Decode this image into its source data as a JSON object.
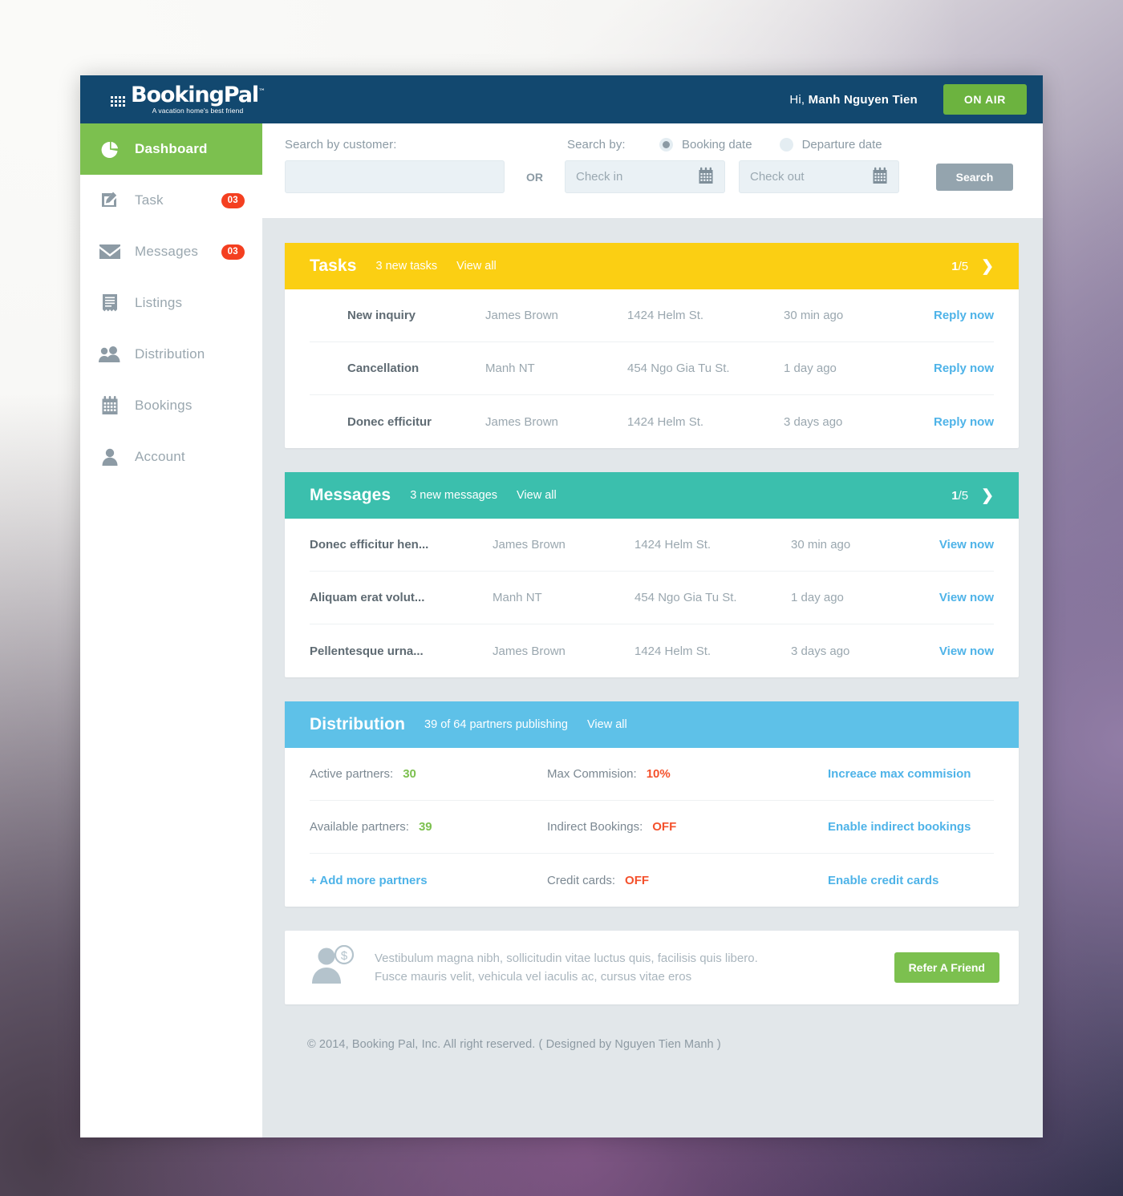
{
  "brand": {
    "logo_main": "BookingPal",
    "logo_tm": "™",
    "logo_sub": "A vacation home's  best friend",
    "accent_blue": "#12486f",
    "accent_green": "#7cc04f",
    "accent_yellow": "#fbcf13",
    "accent_teal": "#3bbfad",
    "accent_lightblue": "#5ec1e8",
    "accent_red": "#f4512c",
    "link_blue": "#4eb3e8"
  },
  "topbar": {
    "greeting_prefix": "Hi, ",
    "user_name": "Manh Nguyen Tien",
    "on_air_label": "ON AIR"
  },
  "sidebar": {
    "items": [
      {
        "label": "Dashboard",
        "icon": "pie-chart-icon",
        "badge": null,
        "active": true
      },
      {
        "label": "Task",
        "icon": "edit-note-icon",
        "badge": "03",
        "active": false
      },
      {
        "label": "Messages",
        "icon": "envelope-icon",
        "badge": "03",
        "active": false
      },
      {
        "label": "Listings",
        "icon": "receipt-icon",
        "badge": null,
        "active": false
      },
      {
        "label": "Distribution",
        "icon": "people-icon",
        "badge": null,
        "active": false
      },
      {
        "label": "Bookings",
        "icon": "calendar-icon",
        "badge": null,
        "active": false
      },
      {
        "label": "Account",
        "icon": "user-icon",
        "badge": null,
        "active": false
      }
    ]
  },
  "search": {
    "customer_label": "Search by customer:",
    "customer_value": "",
    "customer_placeholder": "",
    "or_label": "OR",
    "search_by_label": "Search by:",
    "radios": [
      {
        "label": "Booking date",
        "selected": true
      },
      {
        "label": "Departure date",
        "selected": false
      }
    ],
    "checkin_placeholder": "Check in",
    "checkin_value": "",
    "checkout_placeholder": "Check out",
    "checkout_value": "",
    "search_button": "Search"
  },
  "tasks_panel": {
    "title": "Tasks",
    "subtitle": "3 new tasks",
    "view_all": "View all",
    "page_current": "1",
    "page_sep": "/",
    "page_total": "5",
    "rows": [
      {
        "title": "New inquiry",
        "name": "James Brown",
        "address": "1424 Helm St.",
        "time": "30 min ago",
        "action": "Reply now"
      },
      {
        "title": "Cancellation",
        "name": "Manh NT",
        "address": "454 Ngo Gia Tu St.",
        "time": "1 day ago",
        "action": "Reply now"
      },
      {
        "title": "Donec efficitur",
        "name": "James Brown",
        "address": "1424 Helm St.",
        "time": "3 days ago",
        "action": "Reply now"
      }
    ]
  },
  "messages_panel": {
    "title": "Messages",
    "subtitle": "3 new messages",
    "view_all": "View all",
    "page_current": "1",
    "page_sep": "/",
    "page_total": "5",
    "rows": [
      {
        "title": "Donec efficitur hen...",
        "name": "James Brown",
        "address": "1424 Helm St.",
        "time": "30 min ago",
        "action": "View now"
      },
      {
        "title": "Aliquam erat volut...",
        "name": "Manh NT",
        "address": "454 Ngo Gia Tu St.",
        "time": "1 day ago",
        "action": "View now"
      },
      {
        "title": "Pellentesque urna...",
        "name": "James Brown",
        "address": "1424 Helm St.",
        "time": "3 days ago",
        "action": "View now"
      }
    ]
  },
  "distribution_panel": {
    "title": "Distribution",
    "subtitle": "39 of 64 partners publishing",
    "view_all": "View all",
    "rows": [
      {
        "left_label": "Active partners:",
        "left_value": "30",
        "left_value_color": "green",
        "mid_label": "Max Commision:",
        "mid_value": "10%",
        "mid_value_color": "red",
        "link": "Increace max commision"
      },
      {
        "left_label": "Available partners:",
        "left_value": "39",
        "left_value_color": "green",
        "mid_label": "Indirect Bookings:",
        "mid_value": "OFF",
        "mid_value_color": "red",
        "link": "Enable indirect bookings"
      }
    ],
    "add_partners_link": "+ Add more partners",
    "credit_cards_label": "Credit cards:",
    "credit_cards_value": "OFF",
    "credit_cards_link": "Enable credit cards"
  },
  "referral": {
    "icon": "user-money-icon",
    "line1": "Vestibulum magna nibh, sollicitudin vitae luctus quis, facilisis quis libero.",
    "line2": "Fusce mauris velit, vehicula vel iaculis ac, cursus vitae eros",
    "button": "Refer A Friend"
  },
  "footer": {
    "text": "© 2014, Booking Pal, Inc. All right reserved. ( Designed by Nguyen Tien Manh )"
  }
}
